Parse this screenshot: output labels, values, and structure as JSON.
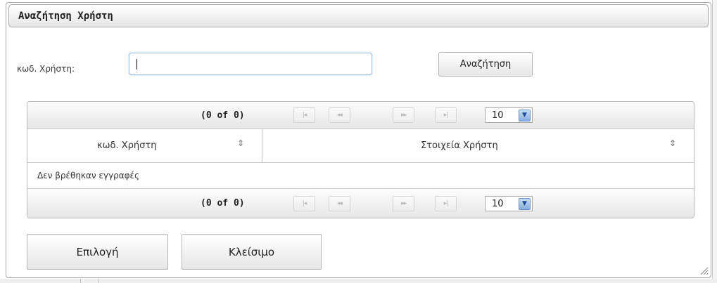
{
  "dialog": {
    "title": "Αναζήτηση Χρήστη",
    "user_code_label": "κωδ. Χρήστη:",
    "search_input_value": "",
    "search_button_label": "Αναζήτηση"
  },
  "table": {
    "page_report_top": "(0 of 0)",
    "page_report_bottom": "(0 of 0)",
    "paginator_buttons": {
      "first": "|◂",
      "prev": "◂◂",
      "next": "▸▸",
      "last": "▸|"
    },
    "rows_per_page": "10",
    "columns": [
      "κωδ. Χρήστη",
      "Στοιχεία Χρήστη"
    ],
    "sort_icon": "⇕",
    "empty_message": "Δεν βρέθηκαν εγγραφές"
  },
  "footer": {
    "select_button_label": "Επιλογή",
    "close_button_label": "Κλείσιμο"
  },
  "colors": {
    "input_focus_border": "#9cc0e4",
    "dropdown_arrow": "#86abe2"
  }
}
